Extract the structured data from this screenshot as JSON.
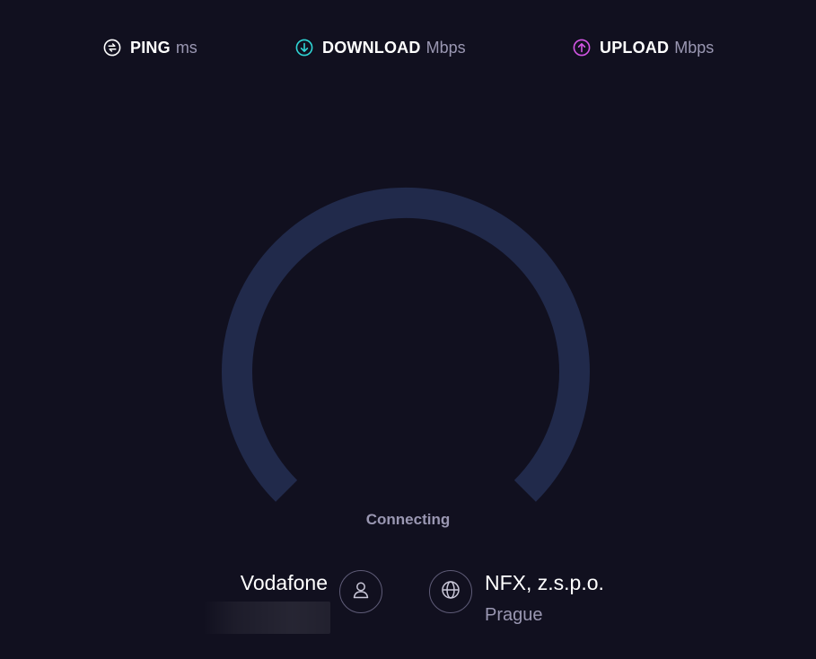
{
  "metrics": {
    "ping": {
      "label": "PING",
      "unit": "ms",
      "icon": "ping-icon",
      "color": "#ffffff"
    },
    "download": {
      "label": "DOWNLOAD",
      "unit": "Mbps",
      "icon": "download-arrow-icon",
      "color": "#2fd6d6"
    },
    "upload": {
      "label": "UPLOAD",
      "unit": "Mbps",
      "icon": "upload-arrow-icon",
      "color": "#d556e6"
    }
  },
  "gauge": {
    "status": "Connecting",
    "track_color": "#212a4b",
    "progress": 0
  },
  "provider": {
    "isp_name": "Vodafone",
    "user_icon": "user-icon"
  },
  "server": {
    "name": "NFX, z.s.p.o.",
    "location": "Prague",
    "icon": "globe-icon"
  },
  "colors": {
    "background": "#11101f",
    "text_primary": "#ffffff",
    "text_secondary": "#9a97b2"
  }
}
